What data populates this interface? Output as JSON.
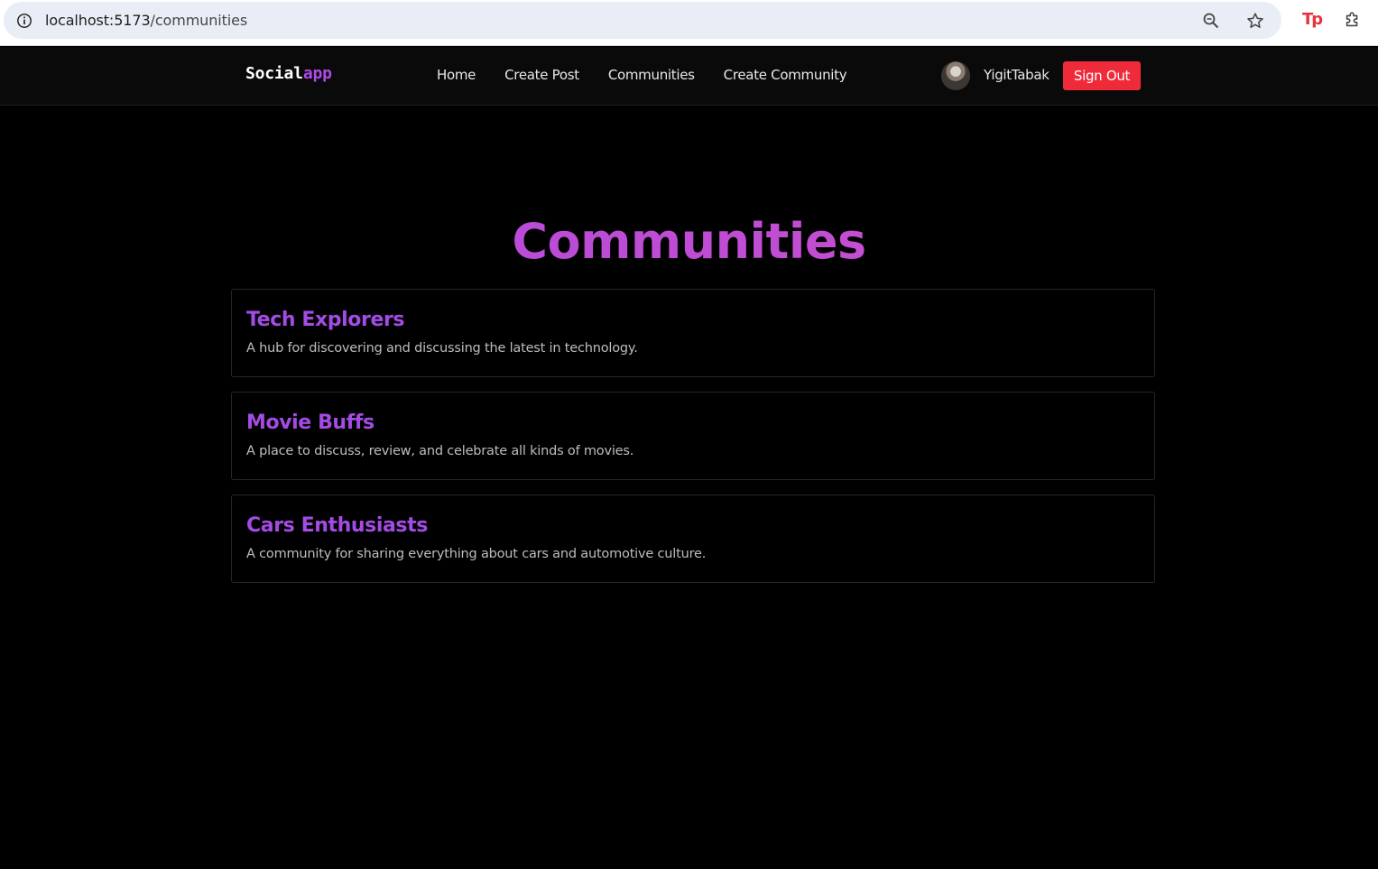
{
  "browser": {
    "url_host": "localhost:5173",
    "url_path": "/communities",
    "extension_badge": "Tp"
  },
  "nav": {
    "brand_main": "Social",
    "brand_accent": "app",
    "links": [
      {
        "label": "Home"
      },
      {
        "label": "Create Post"
      },
      {
        "label": "Communities"
      },
      {
        "label": "Create Community"
      }
    ],
    "username": "YigitTabak",
    "signout_label": "Sign Out"
  },
  "main": {
    "title": "Communities",
    "communities": [
      {
        "name": "Tech Explorers",
        "description": "A hub for discovering and discussing the latest in technology."
      },
      {
        "name": "Movie Buffs",
        "description": "A place to discuss, review, and celebrate all kinds of movies."
      },
      {
        "name": "Cars Enthusiasts",
        "description": "A community for sharing everything about cars and automotive culture."
      }
    ]
  },
  "colors": {
    "accent_purple": "#a44be6",
    "title_gradient_start": "#a94ae0",
    "title_gradient_end": "#d44fc9",
    "signout_red": "#ef2b3a",
    "background": "#000000"
  }
}
